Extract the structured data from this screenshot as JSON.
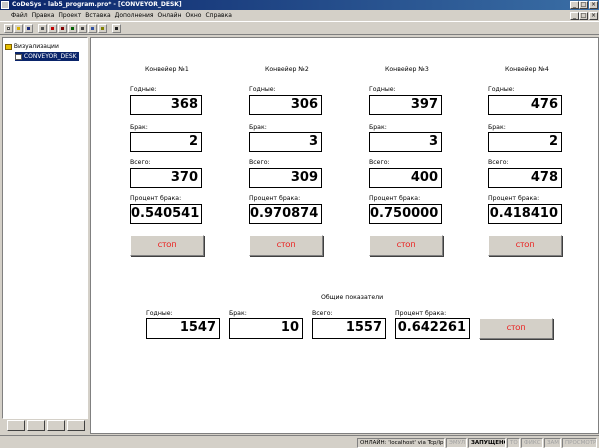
{
  "window": {
    "title": "CoDeSys - lab5_program.pro* - [CONVEYOR_DESK]",
    "min_label": "_",
    "max_label": "□",
    "close_label": "×"
  },
  "menu": [
    "Файл",
    "Правка",
    "Проект",
    "Вставка",
    "Дополнения",
    "Онлайн",
    "Окно",
    "Справка"
  ],
  "toolbar": {
    "icons": [
      "new-icon",
      "open-icon",
      "save-icon",
      "compile-icon",
      "login-icon",
      "logout-icon",
      "run-icon",
      "stop-icon",
      "step-icon",
      "watch-icon",
      "help-icon"
    ]
  },
  "tree": {
    "folder_label": "Визуализации",
    "item_label": "CONVEYOR_DESK"
  },
  "left_tabs": [
    "pou-tab-icon",
    "datatypes-tab-icon",
    "visualization-tab-icon",
    "resources-tab-icon"
  ],
  "labels": {
    "good": "Годные:",
    "defect": "Брак:",
    "total": "Всего:",
    "defect_pct": "Процент брака:",
    "stop": "СТОП",
    "summary_title": "Общие показатели"
  },
  "conveyors": [
    {
      "name": "Конвейер №1",
      "good": "368",
      "defect": "2",
      "total": "370",
      "pct": "0.540541"
    },
    {
      "name": "Конвейер №2",
      "good": "306",
      "defect": "3",
      "total": "309",
      "pct": "0.970874"
    },
    {
      "name": "Конвейер №3",
      "good": "397",
      "defect": "3",
      "total": "400",
      "pct": "0.750000"
    },
    {
      "name": "Конвейер №4",
      "good": "476",
      "defect": "2",
      "total": "478",
      "pct": "0.418410"
    }
  ],
  "summary": {
    "good": "1547",
    "defect": "10",
    "total": "1557",
    "pct": "0.642261"
  },
  "status": {
    "online": "ОНЛАЙН: 'localhost' via Tcp/Ip",
    "sim": "ЭМУЛ",
    "run": "ЗАПУЩЕНО",
    "bp": "ТО",
    "force": "ФИКС",
    "ovr": "ЗАМ",
    "read": "ПРОСМОТР"
  }
}
